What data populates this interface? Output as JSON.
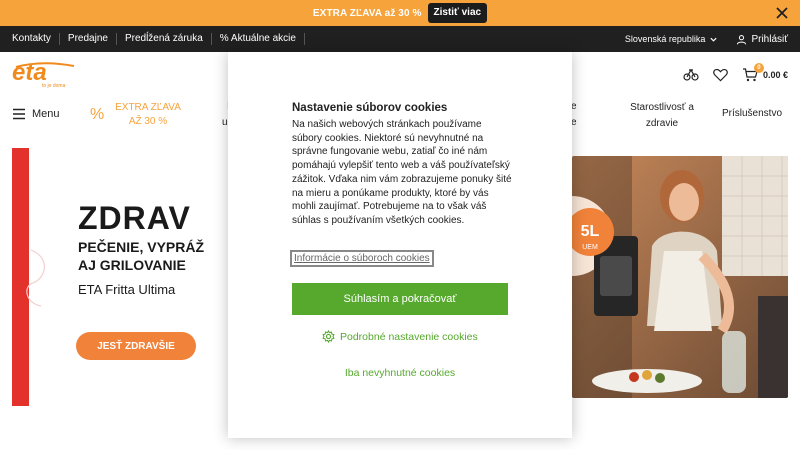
{
  "promo": {
    "text": "EXTRA ZĽAVA až 30 %",
    "button": "Zistiť viac",
    "close_icon": "close-icon"
  },
  "topnav": {
    "links": [
      "Kontakty",
      "Predajne",
      "Predĺžená záruka",
      "% Aktuálne akcie"
    ],
    "country": "Slovenská republika",
    "login": "Prihlásiť"
  },
  "header": {
    "logo": "eta",
    "logo_tagline": "to je doma",
    "cart_total": "0.00 €",
    "cart_count": "0",
    "icons": [
      "compare-icon",
      "heart-icon",
      "cart-icon"
    ]
  },
  "catnav": {
    "menu": "Menu",
    "extra_line1": "EXTRA ZĽAVA",
    "extra_line2": "AŽ 30 %",
    "frag1_line1": "I",
    "frag1_line2": "up",
    "frag2_line1": "e",
    "frag2_line2": "e",
    "care_line1": "Starostlivosť a",
    "care_line2": "zdravie",
    "accessories": "Príslušenstvo"
  },
  "hero": {
    "title": "ZDRAV",
    "sub_line1": "PEČENIE, VYPRÁŽ",
    "sub_line2": "AJ GRILOVANIE",
    "product": "ETA Fritta Ultima",
    "cta": "JESŤ ZDRAVŠIE",
    "badge_line1": "5L",
    "badge_line2": "UEM"
  },
  "cookie_modal": {
    "title": "Nastavenie súborov cookies",
    "body": "Na našich webových stránkach používame súbory cookies. Niektoré sú nevyhnutné na správne fungovanie webu, zatiaľ čo iné nám pomáhajú vylepšiť tento web a váš používateľský zážitok. Vďaka nim vám zobrazujeme ponuky šité na mieru a ponúkame produkty, ktoré by vás mohli zaujímať. Potrebujeme na to však váš súhlas s používaním všetkých cookies.",
    "info_link": "Informácie o súboroch cookies",
    "accept": "Súhlasím a pokračovať",
    "detail_settings": "Podrobné nastavenie cookies",
    "essential_only": "Iba nevyhnutné cookies"
  },
  "colors": {
    "promo": "#f6a33c",
    "topnav": "#202020",
    "accent_orange": "#f0823a",
    "green": "#56a92d",
    "hero_red": "#e3322c"
  }
}
